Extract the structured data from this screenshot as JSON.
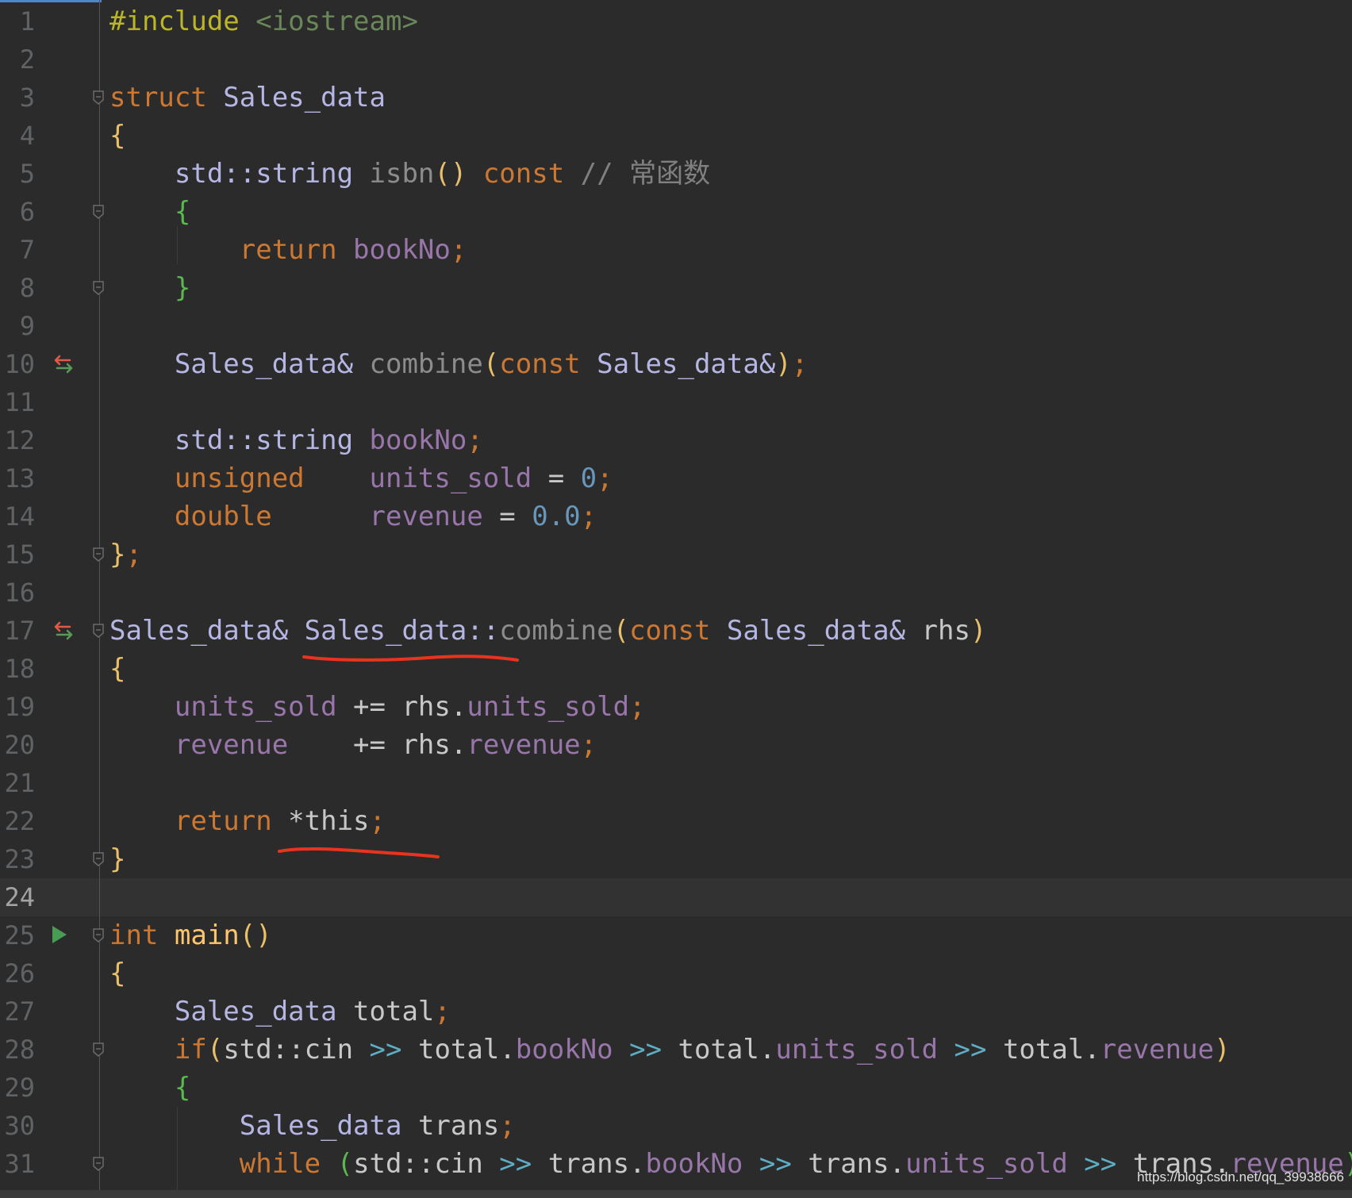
{
  "editor": {
    "language": "C++",
    "current_line": 24,
    "lines": [
      {
        "num": "1",
        "tokens": [
          {
            "text": "#include ",
            "cls": "t-incl"
          },
          {
            "text": "<iostream>",
            "cls": "t-path"
          }
        ]
      },
      {
        "num": "2",
        "tokens": []
      },
      {
        "num": "3",
        "tokens": [
          {
            "text": "struct ",
            "cls": "t-kw"
          },
          {
            "text": "Sales_data",
            "cls": "t-type"
          }
        ]
      },
      {
        "num": "4",
        "tokens": [
          {
            "text": "{",
            "cls": "t-p1"
          }
        ]
      },
      {
        "num": "5",
        "tokens": [
          {
            "text": "    std::string ",
            "cls": "t-type"
          },
          {
            "text": "isbn",
            "cls": "t-fngray"
          },
          {
            "text": "()",
            "cls": "t-p1"
          },
          {
            "text": " const ",
            "cls": "t-kw"
          },
          {
            "text": "// 常函数",
            "cls": "t-comment"
          }
        ]
      },
      {
        "num": "6",
        "tokens": [
          {
            "text": "    {",
            "cls": "t-p2"
          }
        ]
      },
      {
        "num": "7",
        "tokens": [
          {
            "text": "        return ",
            "cls": "t-kw"
          },
          {
            "text": "bookNo",
            "cls": "t-field"
          },
          {
            "text": ";",
            "cls": "t-kw"
          }
        ]
      },
      {
        "num": "8",
        "tokens": [
          {
            "text": "    }",
            "cls": "t-p2"
          }
        ]
      },
      {
        "num": "9",
        "tokens": []
      },
      {
        "num": "10",
        "tokens": [
          {
            "text": "    Sales_data& ",
            "cls": "t-type"
          },
          {
            "text": "combine",
            "cls": "t-fngray"
          },
          {
            "text": "(",
            "cls": "t-p1"
          },
          {
            "text": "const ",
            "cls": "t-kw"
          },
          {
            "text": "Sales_data&",
            "cls": "t-type"
          },
          {
            "text": ")",
            "cls": "t-p1"
          },
          {
            "text": ";",
            "cls": "t-kw"
          }
        ]
      },
      {
        "num": "11",
        "tokens": []
      },
      {
        "num": "12",
        "tokens": [
          {
            "text": "    std::string ",
            "cls": "t-type"
          },
          {
            "text": "bookNo",
            "cls": "t-field"
          },
          {
            "text": ";",
            "cls": "t-kw"
          }
        ]
      },
      {
        "num": "13",
        "tokens": [
          {
            "text": "    unsigned    ",
            "cls": "t-kw"
          },
          {
            "text": "units_sold",
            "cls": "t-field"
          },
          {
            "text": " = ",
            "cls": "t-pl"
          },
          {
            "text": "0",
            "cls": "t-num"
          },
          {
            "text": ";",
            "cls": "t-kw"
          }
        ]
      },
      {
        "num": "14",
        "tokens": [
          {
            "text": "    double      ",
            "cls": "t-kw"
          },
          {
            "text": "revenue",
            "cls": "t-field"
          },
          {
            "text": " = ",
            "cls": "t-pl"
          },
          {
            "text": "0.0",
            "cls": "t-num"
          },
          {
            "text": ";",
            "cls": "t-kw"
          }
        ]
      },
      {
        "num": "15",
        "tokens": [
          {
            "text": "}",
            "cls": "t-p1"
          },
          {
            "text": ";",
            "cls": "t-kw"
          }
        ]
      },
      {
        "num": "16",
        "tokens": []
      },
      {
        "num": "17",
        "tokens": [
          {
            "text": "Sales_data& Sales_data::",
            "cls": "t-type"
          },
          {
            "text": "combine",
            "cls": "t-fngray"
          },
          {
            "text": "(",
            "cls": "t-p1"
          },
          {
            "text": "const ",
            "cls": "t-kw"
          },
          {
            "text": "Sales_data& ",
            "cls": "t-type"
          },
          {
            "text": "rhs",
            "cls": "t-pl"
          },
          {
            "text": ")",
            "cls": "t-p1"
          }
        ]
      },
      {
        "num": "18",
        "tokens": [
          {
            "text": "{",
            "cls": "t-p1"
          }
        ]
      },
      {
        "num": "19",
        "tokens": [
          {
            "text": "    units_sold",
            "cls": "t-field"
          },
          {
            "text": " += rhs.",
            "cls": "t-pl"
          },
          {
            "text": "units_sold",
            "cls": "t-field"
          },
          {
            "text": ";",
            "cls": "t-kw"
          }
        ]
      },
      {
        "num": "20",
        "tokens": [
          {
            "text": "    revenue",
            "cls": "t-field"
          },
          {
            "text": "    += rhs.",
            "cls": "t-pl"
          },
          {
            "text": "revenue",
            "cls": "t-field"
          },
          {
            "text": ";",
            "cls": "t-kw"
          }
        ]
      },
      {
        "num": "21",
        "tokens": []
      },
      {
        "num": "22",
        "tokens": [
          {
            "text": "    return ",
            "cls": "t-kw"
          },
          {
            "text": "*this",
            "cls": "t-pl"
          },
          {
            "text": ";",
            "cls": "t-kw"
          }
        ]
      },
      {
        "num": "23",
        "tokens": [
          {
            "text": "}",
            "cls": "t-p1"
          }
        ]
      },
      {
        "num": "24",
        "tokens": []
      },
      {
        "num": "25",
        "tokens": [
          {
            "text": "int ",
            "cls": "t-kw"
          },
          {
            "text": "main",
            "cls": "t-func"
          },
          {
            "text": "()",
            "cls": "t-p1"
          }
        ]
      },
      {
        "num": "26",
        "tokens": [
          {
            "text": "{",
            "cls": "t-p1"
          }
        ]
      },
      {
        "num": "27",
        "tokens": [
          {
            "text": "    Sales_data ",
            "cls": "t-type"
          },
          {
            "text": "total",
            "cls": "t-pl"
          },
          {
            "text": ";",
            "cls": "t-kw"
          }
        ]
      },
      {
        "num": "28",
        "tokens": [
          {
            "text": "    if",
            "cls": "t-kw"
          },
          {
            "text": "(",
            "cls": "t-p1"
          },
          {
            "text": "std::cin ",
            "cls": "t-pl"
          },
          {
            "text": ">> ",
            "cls": "t-p3"
          },
          {
            "text": "total.",
            "cls": "t-pl"
          },
          {
            "text": "bookNo",
            "cls": "t-field"
          },
          {
            "text": " >> ",
            "cls": "t-p3"
          },
          {
            "text": "total.",
            "cls": "t-pl"
          },
          {
            "text": "units_sold",
            "cls": "t-field"
          },
          {
            "text": " >> ",
            "cls": "t-p3"
          },
          {
            "text": "total.",
            "cls": "t-pl"
          },
          {
            "text": "revenue",
            "cls": "t-field"
          },
          {
            "text": ")",
            "cls": "t-p1"
          }
        ]
      },
      {
        "num": "29",
        "tokens": [
          {
            "text": "    {",
            "cls": "t-p2"
          }
        ]
      },
      {
        "num": "30",
        "tokens": [
          {
            "text": "        Sales_data ",
            "cls": "t-type"
          },
          {
            "text": "trans",
            "cls": "t-pl"
          },
          {
            "text": ";",
            "cls": "t-kw"
          }
        ]
      },
      {
        "num": "31",
        "tokens": [
          {
            "text": "        while ",
            "cls": "t-kw"
          },
          {
            "text": "(",
            "cls": "t-p2"
          },
          {
            "text": "std::cin ",
            "cls": "t-pl"
          },
          {
            "text": ">> ",
            "cls": "t-p3"
          },
          {
            "text": "trans.",
            "cls": "t-pl"
          },
          {
            "text": "bookNo",
            "cls": "t-field"
          },
          {
            "text": " >> ",
            "cls": "t-p3"
          },
          {
            "text": "trans.",
            "cls": "t-pl"
          },
          {
            "text": "units_sold",
            "cls": "t-field"
          },
          {
            "text": " >> ",
            "cls": "t-p3"
          },
          {
            "text": "trans.",
            "cls": "t-pl"
          },
          {
            "text": "revenue",
            "cls": "t-field"
          },
          {
            "text": ")",
            "cls": "t-p2"
          }
        ]
      }
    ],
    "fold_markers_on_lines": [
      3,
      6,
      8,
      15,
      17,
      23,
      25,
      28,
      31
    ],
    "override_icon_lines": [
      10,
      17
    ],
    "run_icon_line": 25
  },
  "annotations": {
    "underline_color": "#e8341c",
    "underlined_text": [
      "Sales_data::",
      "*this;"
    ]
  },
  "watermark": {
    "text": "https://blog.csdn.net/qq_39938666"
  },
  "colors": {
    "background": "#2b2b2b",
    "keyword": "#cc7832",
    "type": "#b5b6e3",
    "field": "#9876aa",
    "number": "#6897bb",
    "comment": "#808080"
  }
}
